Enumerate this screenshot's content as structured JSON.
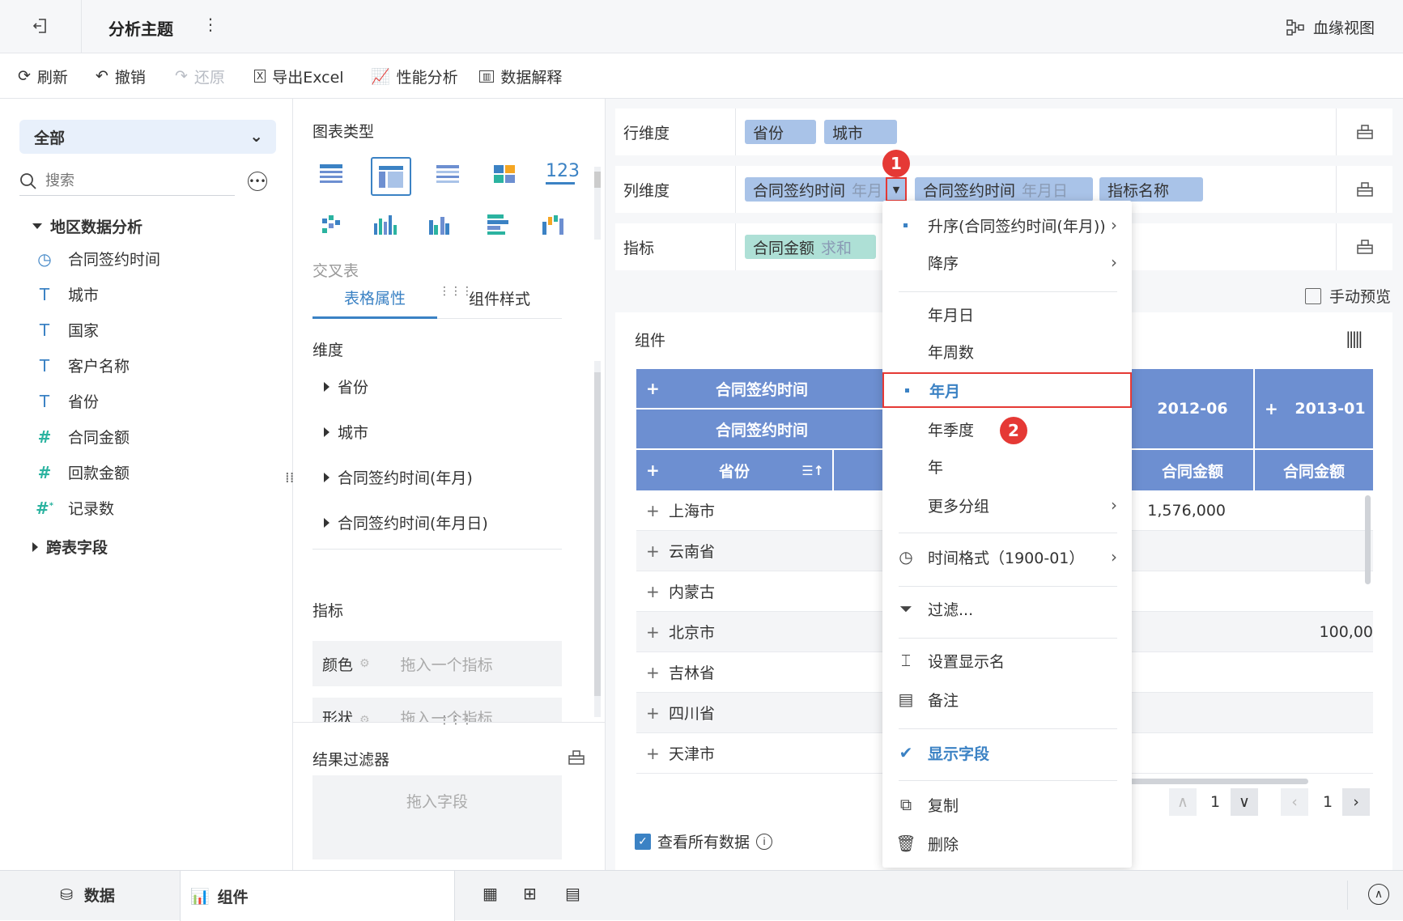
{
  "header": {
    "title": "分析主题",
    "lineage_label": "血缘视图"
  },
  "toolbar": {
    "refresh": "刷新",
    "undo": "撤销",
    "redo": "还原",
    "export": "导出Excel",
    "perf": "性能分析",
    "explain": "数据解释"
  },
  "left": {
    "scope_select": "全部",
    "search_placeholder": "搜索",
    "group1": "地区数据分析",
    "fields": [
      {
        "label": "合同签约时间",
        "type": "time-icon"
      },
      {
        "label": "城市",
        "type": "text-type-icon"
      },
      {
        "label": "国家",
        "type": "text-type-icon"
      },
      {
        "label": "客户名称",
        "type": "text-type-icon"
      },
      {
        "label": "省份",
        "type": "text-type-icon"
      },
      {
        "label": "合同金额",
        "type": "number-type-icon"
      },
      {
        "label": "回款金额",
        "type": "number-type-icon"
      },
      {
        "label": "记录数",
        "type": "count-type-icon"
      }
    ],
    "group2": "跨表字段"
  },
  "mid": {
    "chart_type_label": "图表类型",
    "chart_caption": "交叉表",
    "tab_active": "表格属性",
    "tab_other": "组件样式",
    "dim_label": "维度",
    "dims": [
      "省份",
      "城市",
      "合同签约时间(年月)",
      "合同签约时间(年月日)"
    ],
    "metric_label": "指标",
    "color_label": "颜色",
    "color_ph": "拖入一个指标",
    "shape_label": "形状",
    "shape_ph": "拖入一个指标",
    "result_filter": "结果过滤器",
    "drop_field": "拖入字段"
  },
  "zones": {
    "row_label": "行维度",
    "row_chips": [
      "省份",
      "城市"
    ],
    "col_label": "列维度",
    "col_chip1": "合同签约时间",
    "col_chip1_sub": "年月",
    "col_chip2": "合同签约时间",
    "col_chip2_sub": "年月日",
    "col_chip3": "指标名称",
    "metric_label": "指标",
    "metric_chip": "合同金额",
    "metric_chip_sub": "求和"
  },
  "manual_preview": "手动预览",
  "component": {
    "title": "组件"
  },
  "table": {
    "hdr_time": "合同签约时间",
    "hdr_time2": "合同签约时间",
    "hdr_province": "省份",
    "col_2012_06": "2012-06",
    "col_2013_01": "2013-01",
    "metric": "合同金额",
    "metric2": "合同金额",
    "rows": [
      {
        "name": "上海市",
        "v1": "1,576,000",
        "v2": ""
      },
      {
        "name": "云南省",
        "v1": "",
        "v2": ""
      },
      {
        "name": "内蒙古",
        "v1": "",
        "v2": ""
      },
      {
        "name": "北京市",
        "v1": "",
        "v2": "100,00"
      },
      {
        "name": "吉林省",
        "v1": "",
        "v2": ""
      },
      {
        "name": "四川省",
        "v1": "",
        "v2": ""
      },
      {
        "name": "天津市",
        "v1": "",
        "v2": ""
      }
    ]
  },
  "pager": {
    "p1": "1",
    "p2": "1"
  },
  "view_all": "查看所有数据",
  "menu": {
    "asc": "升序(合同签约时间(年月))",
    "desc": "降序",
    "ymd": "年月日",
    "yw": "年周数",
    "ym": "年月",
    "yq": "年季度",
    "y": "年",
    "more": "更多分组",
    "timefmt": "时间格式（1900-01）",
    "filter": "过滤...",
    "rename": "设置显示名",
    "note": "备注",
    "show": "显示字段",
    "copy": "复制",
    "delete": "删除"
  },
  "badges": {
    "b1": "1",
    "b2": "2"
  },
  "bottom": {
    "data_tab": "数据",
    "comp_tab": "组件"
  },
  "colors": {
    "accent": "#3b82c4",
    "header": "#6d8fd1",
    "chip": "#a9c3e8",
    "chip_green": "#aee0d6",
    "highlight": "#e53935"
  }
}
